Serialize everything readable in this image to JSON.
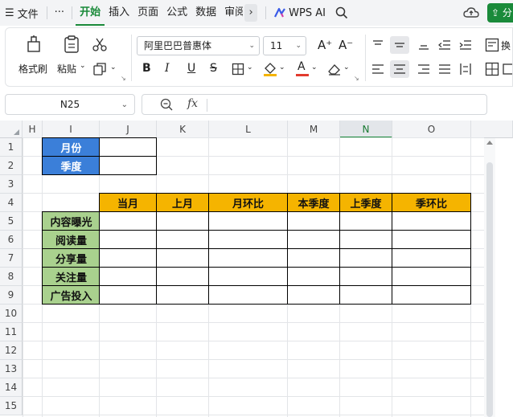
{
  "menubar": {
    "file_label": "文件",
    "more_label": "···",
    "tabs": [
      {
        "label": "开始",
        "active": true
      },
      {
        "label": "插入",
        "active": false
      },
      {
        "label": "页面",
        "active": false
      },
      {
        "label": "公式",
        "active": false
      },
      {
        "label": "数据",
        "active": false
      },
      {
        "label": "审阅",
        "active": false
      }
    ],
    "chevron": "›",
    "wps_ai_label": "WPS AI",
    "share_label": "分"
  },
  "ribbon": {
    "format_painter_label": "格式刷",
    "paste_label": "粘贴",
    "font_name": "阿里巴巴普惠体",
    "font_size": "11",
    "bold": "B",
    "italic": "I",
    "underline": "U",
    "strike": "S",
    "font_color_glyph": "A",
    "increase_font": "A⁺",
    "decrease_font": "A⁻",
    "extra_label": "换"
  },
  "formula_bar": {
    "cell_ref": "N25",
    "fx_label": "fx",
    "formula": ""
  },
  "grid": {
    "columns": [
      "H",
      "I",
      "J",
      "K",
      "L",
      "M",
      "N",
      "O"
    ],
    "selected_column": "N",
    "rows": [
      "1",
      "2",
      "3",
      "4",
      "5",
      "6",
      "7",
      "8",
      "9",
      "10",
      "11",
      "12",
      "13",
      "14",
      "15"
    ],
    "labels_top": [
      "月份",
      "季度"
    ],
    "header_row": [
      "当月",
      "上月",
      "月环比",
      "本季度",
      "上季度",
      "季环比"
    ],
    "row_labels": [
      "内容曝光",
      "阅读量",
      "分享量",
      "关注量",
      "广告投入"
    ]
  },
  "colors": {
    "accent_green": "#1a8a3a",
    "label_blue": "#3b7fd9",
    "header_orange": "#f5b400",
    "row_green": "#a9d18e"
  }
}
